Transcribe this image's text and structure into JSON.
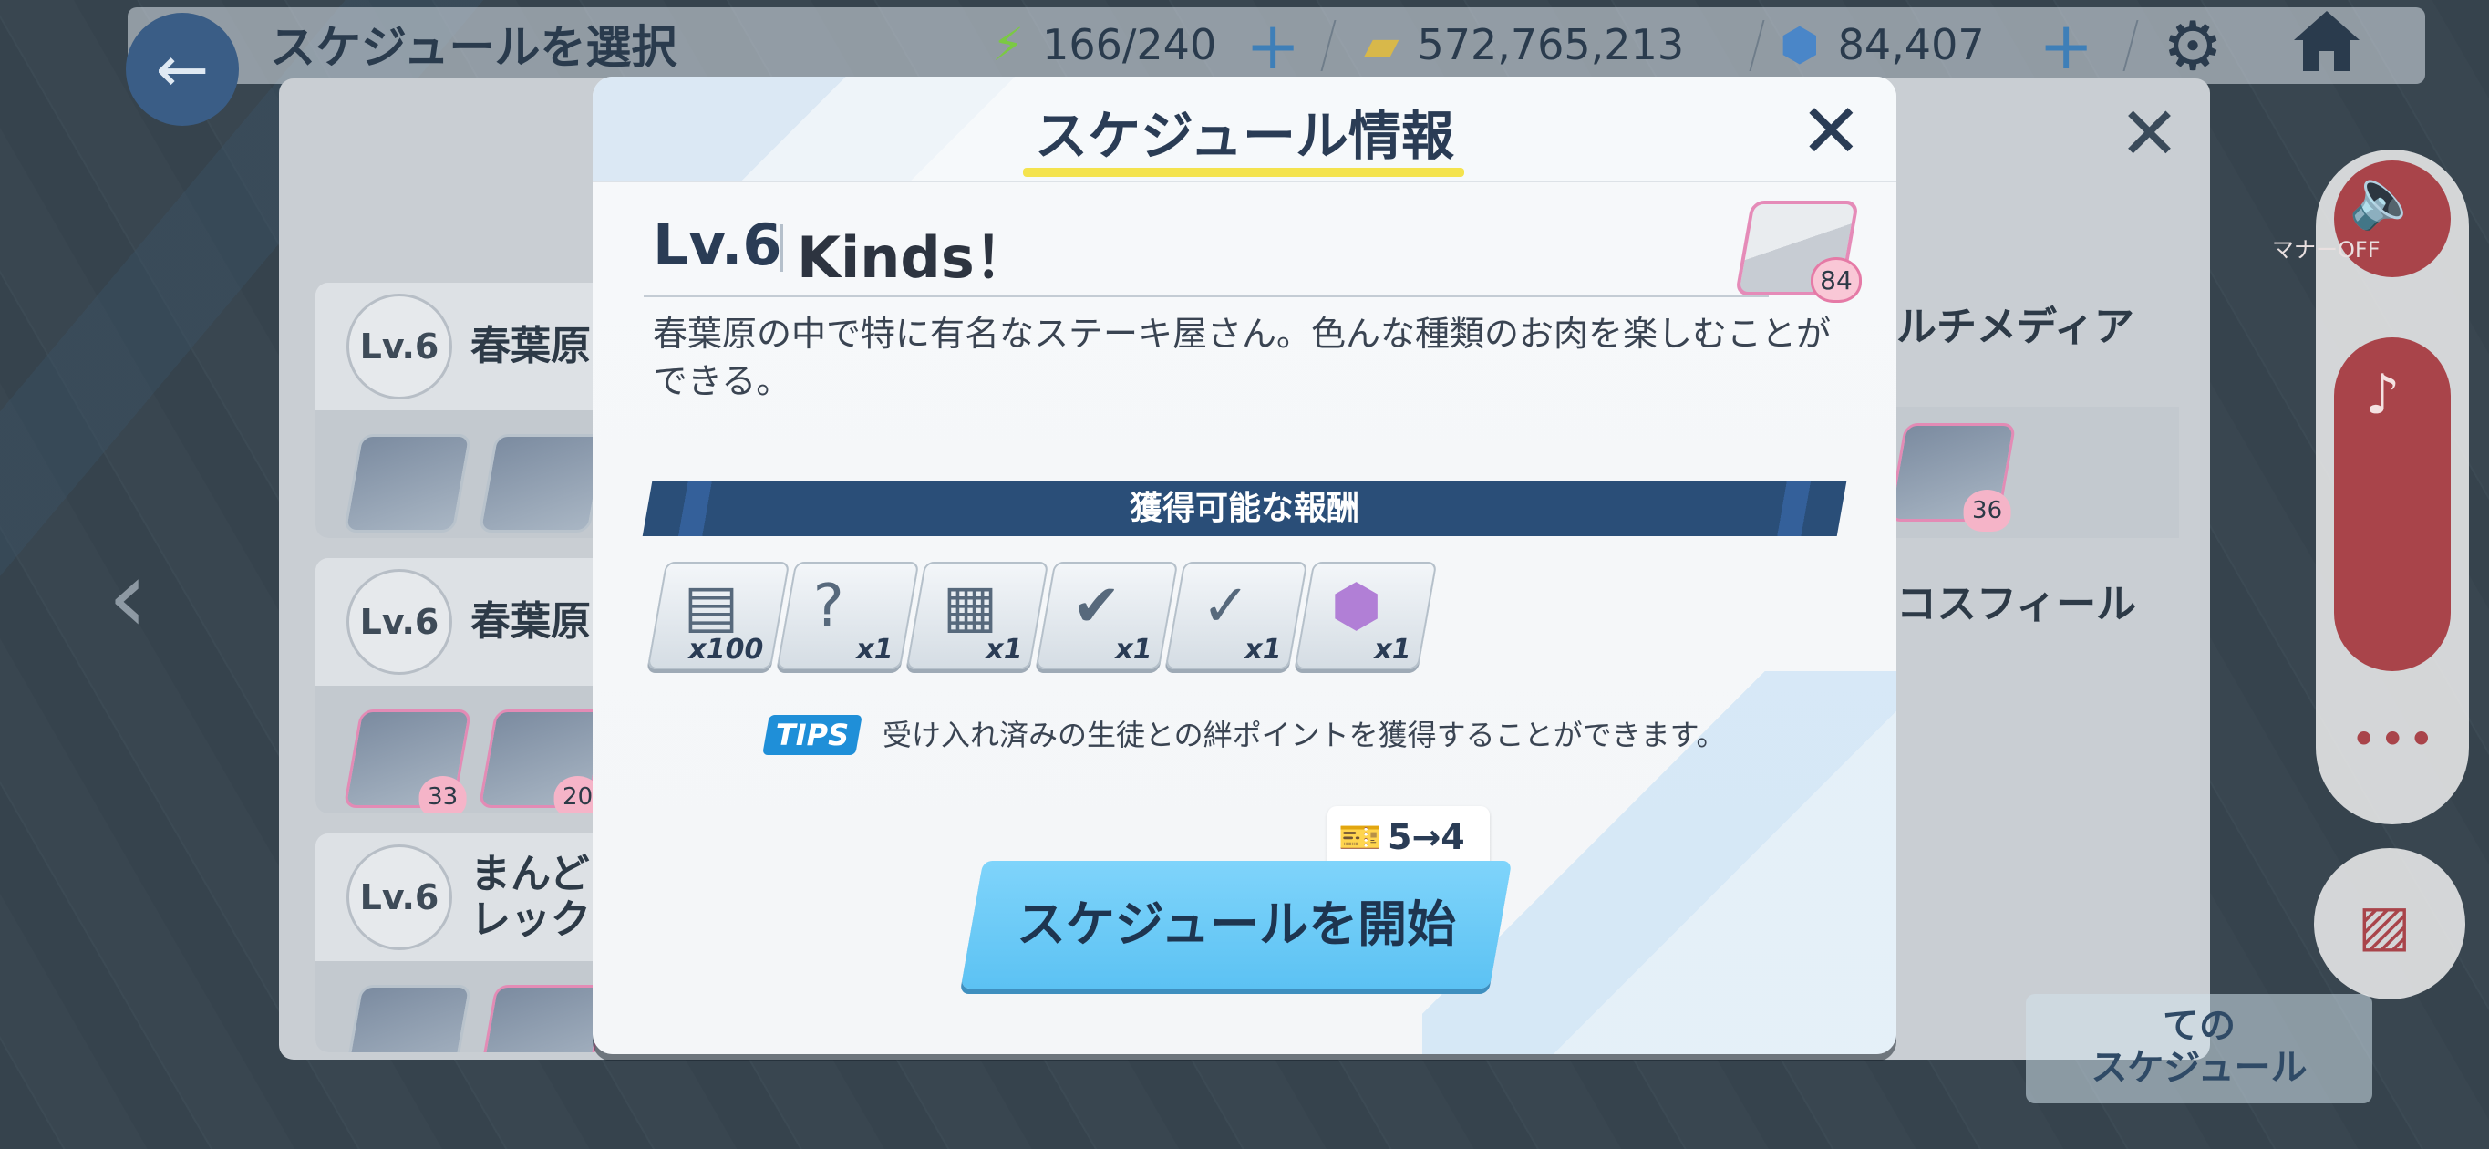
{
  "header": {
    "title": "スケジュールを選択",
    "ap": "166/240",
    "credits": "572,765,213",
    "gems": "84,407"
  },
  "schedule_list": {
    "cards": [
      {
        "level": "Lv.6",
        "name": "春葉原",
        "bonds": []
      },
      {
        "level": "Lv.6",
        "name": "春葉原",
        "bonds": [
          "33",
          "20"
        ]
      },
      {
        "level": "Lv.6",
        "name_line1": "まんど",
        "name_line2": "レック",
        "bonds": []
      }
    ],
    "right_partial": [
      "ルチメディア",
      "コスフィール"
    ],
    "right_bond": "36",
    "bottom_button_line1": "ての",
    "bottom_button_line2": "スケジュール"
  },
  "side_controls": {
    "manner_label": "マナーOFF"
  },
  "modal": {
    "title": "スケジュール情報",
    "level": "Lv.6",
    "location_name": "Kinds！",
    "character_bond": "84",
    "description": "春葉原の中で特に有名なステーキ屋さん。色んな種類のお肉を楽しむことができる。",
    "reward_header": "獲得可能な報酬",
    "rewards": [
      {
        "icon": "exp-report-icon",
        "qty": "x100"
      },
      {
        "icon": "mystery-gift-icon",
        "qty": "x1"
      },
      {
        "icon": "mystery-gift-box-icon",
        "qty": "x1"
      },
      {
        "icon": "ex-gift-icon",
        "qty": "x1"
      },
      {
        "icon": "select-gift-icon",
        "qty": "x1"
      },
      {
        "icon": "student-eleph-icon",
        "qty": "x1"
      }
    ],
    "tips_label": "TIPS",
    "tips_text": "受け入れ済みの生徒との絆ポイントを獲得することができます。",
    "ticket_change": "5→4",
    "start_button": "スケジュールを開始"
  },
  "colors": {
    "accent_blue": "#5cc2f3",
    "banner_navy": "#2a4e78",
    "title_underline": "#f4e34e",
    "side_red": "#a9444a"
  }
}
